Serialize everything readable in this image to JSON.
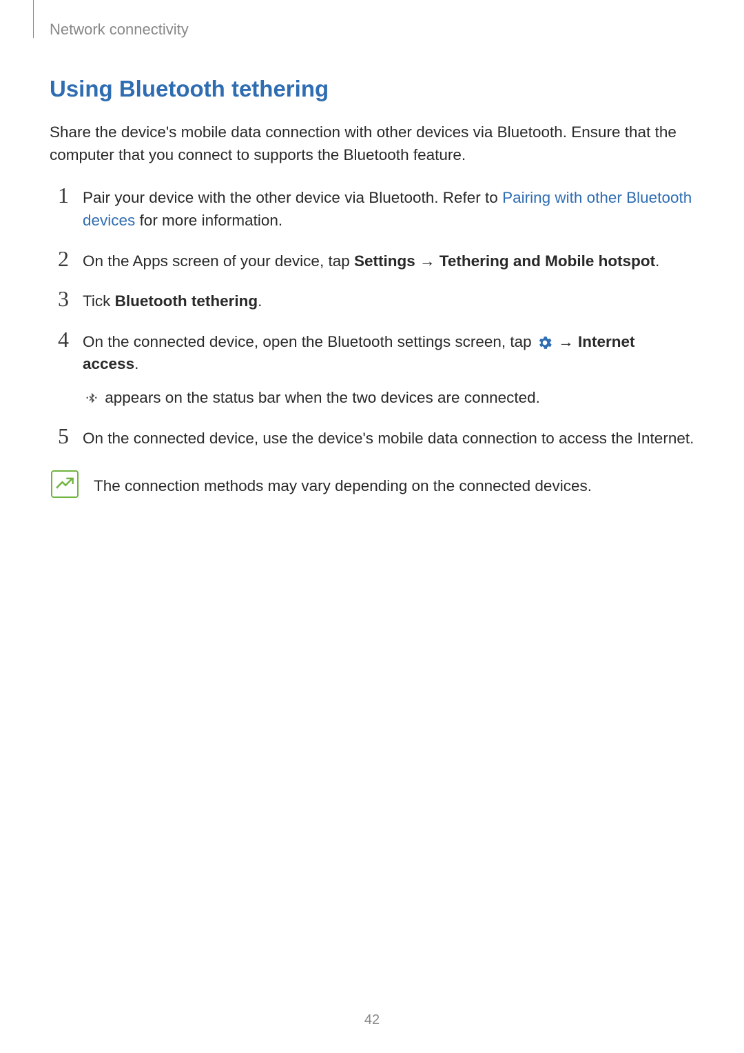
{
  "breadcrumb": "Network connectivity",
  "section_title": "Using Bluetooth tethering",
  "intro": "Share the device's mobile data connection with other devices via Bluetooth. Ensure that the computer that you connect to supports the Bluetooth feature.",
  "steps": {
    "s1": {
      "num": "1",
      "pre": "Pair your device with the other device via Bluetooth. Refer to ",
      "link": "Pairing with other Bluetooth devices",
      "post": " for more information."
    },
    "s2": {
      "num": "2",
      "pre": "On the Apps screen of your device, tap ",
      "settings": "Settings",
      "arrow": " → ",
      "tethering": "Tethering and Mobile hotspot",
      "period": "."
    },
    "s3": {
      "num": "3",
      "pre": "Tick ",
      "bt": "Bluetooth tethering",
      "period": "."
    },
    "s4": {
      "num": "4",
      "pre": "On the connected device, open the Bluetooth settings screen, tap ",
      "arrow": " → ",
      "internet": "Internet access",
      "period": ".",
      "sub_post": " appears on the status bar when the two devices are connected."
    },
    "s5": {
      "num": "5",
      "text": "On the connected device, use the device's mobile data connection to access the Internet."
    }
  },
  "note": "The connection methods may vary depending on the connected devices.",
  "page_number": "42"
}
